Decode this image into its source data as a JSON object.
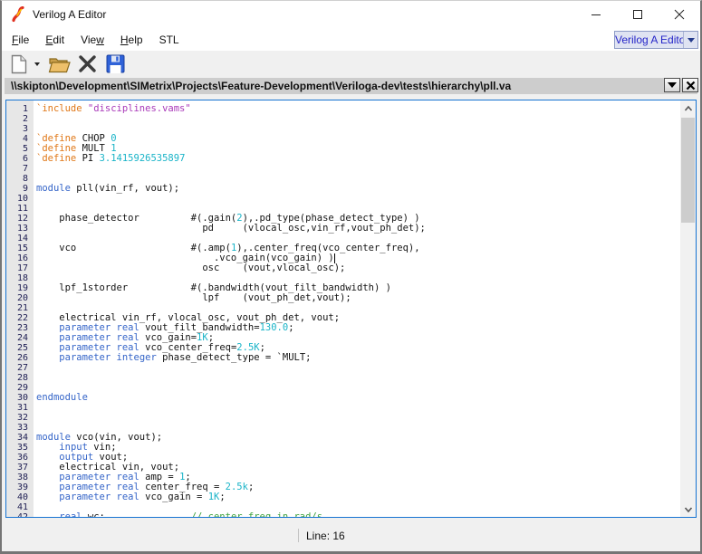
{
  "window": {
    "title": "Verilog A Editor",
    "controls": [
      "minimize",
      "maximize",
      "close"
    ]
  },
  "menu": {
    "items": [
      {
        "label": "File",
        "u": 0
      },
      {
        "label": "Edit",
        "u": 0
      },
      {
        "label": "View",
        "u": 3
      },
      {
        "label": "Help",
        "u": 0
      },
      {
        "label": "STL",
        "u": -1
      }
    ],
    "selector_value": "Verilog A Editor"
  },
  "toolbar": {
    "buttons": [
      "new-file",
      "new-file-dropdown",
      "open-file",
      "close-file",
      "save-file"
    ]
  },
  "path_bar": {
    "path": "\\\\skipton\\Development\\SIMetrix\\Projects\\Feature-Development\\Veriloga-dev\\tests\\hierarchy\\pll.va"
  },
  "editor": {
    "cursor_line": 16,
    "lines": [
      [
        [
          "pp",
          "`include"
        ],
        [
          "t",
          " "
        ],
        [
          "str",
          "\"disciplines.vams\""
        ]
      ],
      [],
      [],
      [
        [
          "pp",
          "`define"
        ],
        [
          "t",
          " CHOP "
        ],
        [
          "num",
          "0"
        ]
      ],
      [
        [
          "pp",
          "`define"
        ],
        [
          "t",
          " MULT "
        ],
        [
          "num",
          "1"
        ]
      ],
      [
        [
          "pp",
          "`define"
        ],
        [
          "t",
          " PI "
        ],
        [
          "num",
          "3.1415926535897"
        ]
      ],
      [],
      [],
      [
        [
          "kw",
          "module"
        ],
        [
          "t",
          " pll(vin_rf, vout);"
        ]
      ],
      [],
      [],
      [
        [
          "t",
          "    phase_detector         #(.gain("
        ],
        [
          "num",
          "2"
        ],
        [
          "t",
          "),.pd_type(phase_detect_type) )"
        ]
      ],
      [
        [
          "t",
          "                             pd     (vlocal_osc,vin_rf,vout_ph_det);"
        ]
      ],
      [],
      [
        [
          "t",
          "    vco                    #(.amp("
        ],
        [
          "num",
          "1"
        ],
        [
          "t",
          "),.center_freq(vco_center_freq),"
        ]
      ],
      [
        [
          "t",
          "                               .vco_gain(vco_gain) )"
        ]
      ],
      [
        [
          "t",
          "                             osc    (vout,vlocal_osc);"
        ]
      ],
      [],
      [
        [
          "t",
          "    lpf_1storder           #(.bandwidth(vout_filt_bandwidth) )"
        ]
      ],
      [
        [
          "t",
          "                             lpf    (vout_ph_det,vout);"
        ]
      ],
      [],
      [
        [
          "t",
          "    electrical vin_rf, vlocal_osc, vout_ph_det, vout;"
        ]
      ],
      [
        [
          "t",
          "    "
        ],
        [
          "kw",
          "parameter"
        ],
        [
          "t",
          " "
        ],
        [
          "kw",
          "real"
        ],
        [
          "t",
          " vout_filt_bandwidth="
        ],
        [
          "num",
          "130.0"
        ],
        [
          "t",
          ";"
        ]
      ],
      [
        [
          "t",
          "    "
        ],
        [
          "kw",
          "parameter"
        ],
        [
          "t",
          " "
        ],
        [
          "kw",
          "real"
        ],
        [
          "t",
          " vco_gain="
        ],
        [
          "num",
          "1K"
        ],
        [
          "t",
          ";"
        ]
      ],
      [
        [
          "t",
          "    "
        ],
        [
          "kw",
          "parameter"
        ],
        [
          "t",
          " "
        ],
        [
          "kw",
          "real"
        ],
        [
          "t",
          " vco_center_freq="
        ],
        [
          "num",
          "2.5K"
        ],
        [
          "t",
          ";"
        ]
      ],
      [
        [
          "t",
          "    "
        ],
        [
          "kw",
          "parameter"
        ],
        [
          "t",
          " "
        ],
        [
          "kw",
          "integer"
        ],
        [
          "t",
          " phase_detect_type = `MULT;"
        ]
      ],
      [],
      [],
      [],
      [
        [
          "kw",
          "endmodule"
        ]
      ],
      [],
      [],
      [],
      [
        [
          "kw",
          "module"
        ],
        [
          "t",
          " vco(vin, vout);"
        ]
      ],
      [
        [
          "t",
          "    "
        ],
        [
          "kw",
          "input"
        ],
        [
          "t",
          " vin;"
        ]
      ],
      [
        [
          "t",
          "    "
        ],
        [
          "kw",
          "output"
        ],
        [
          "t",
          " vout;"
        ]
      ],
      [
        [
          "t",
          "    electrical vin, vout;"
        ]
      ],
      [
        [
          "t",
          "    "
        ],
        [
          "kw",
          "parameter"
        ],
        [
          "t",
          " "
        ],
        [
          "kw",
          "real"
        ],
        [
          "t",
          " amp = "
        ],
        [
          "num",
          "1"
        ],
        [
          "t",
          ";"
        ]
      ],
      [
        [
          "t",
          "    "
        ],
        [
          "kw",
          "parameter"
        ],
        [
          "t",
          " "
        ],
        [
          "kw",
          "real"
        ],
        [
          "t",
          " center_freq = "
        ],
        [
          "num",
          "2.5k"
        ],
        [
          "t",
          ";"
        ]
      ],
      [
        [
          "t",
          "    "
        ],
        [
          "kw",
          "parameter"
        ],
        [
          "t",
          " "
        ],
        [
          "kw",
          "real"
        ],
        [
          "t",
          " vco_gain = "
        ],
        [
          "num",
          "1K"
        ],
        [
          "t",
          ";"
        ]
      ],
      [],
      [
        [
          "t",
          "    "
        ],
        [
          "kw",
          "real"
        ],
        [
          "t",
          " wc;               "
        ],
        [
          "cmt",
          "// center freq in rad/s"
        ]
      ]
    ]
  },
  "status_bar": {
    "line_indicator": "Line: 16"
  },
  "colors": {
    "accent_border": "#1673d2",
    "keyword": "#3565c8",
    "preprocessor": "#e07818",
    "string": "#a939b9",
    "number": "#1ab4c8",
    "comment": "#3fa23f",
    "text": "#141414",
    "selector_text": "#2424c8"
  }
}
